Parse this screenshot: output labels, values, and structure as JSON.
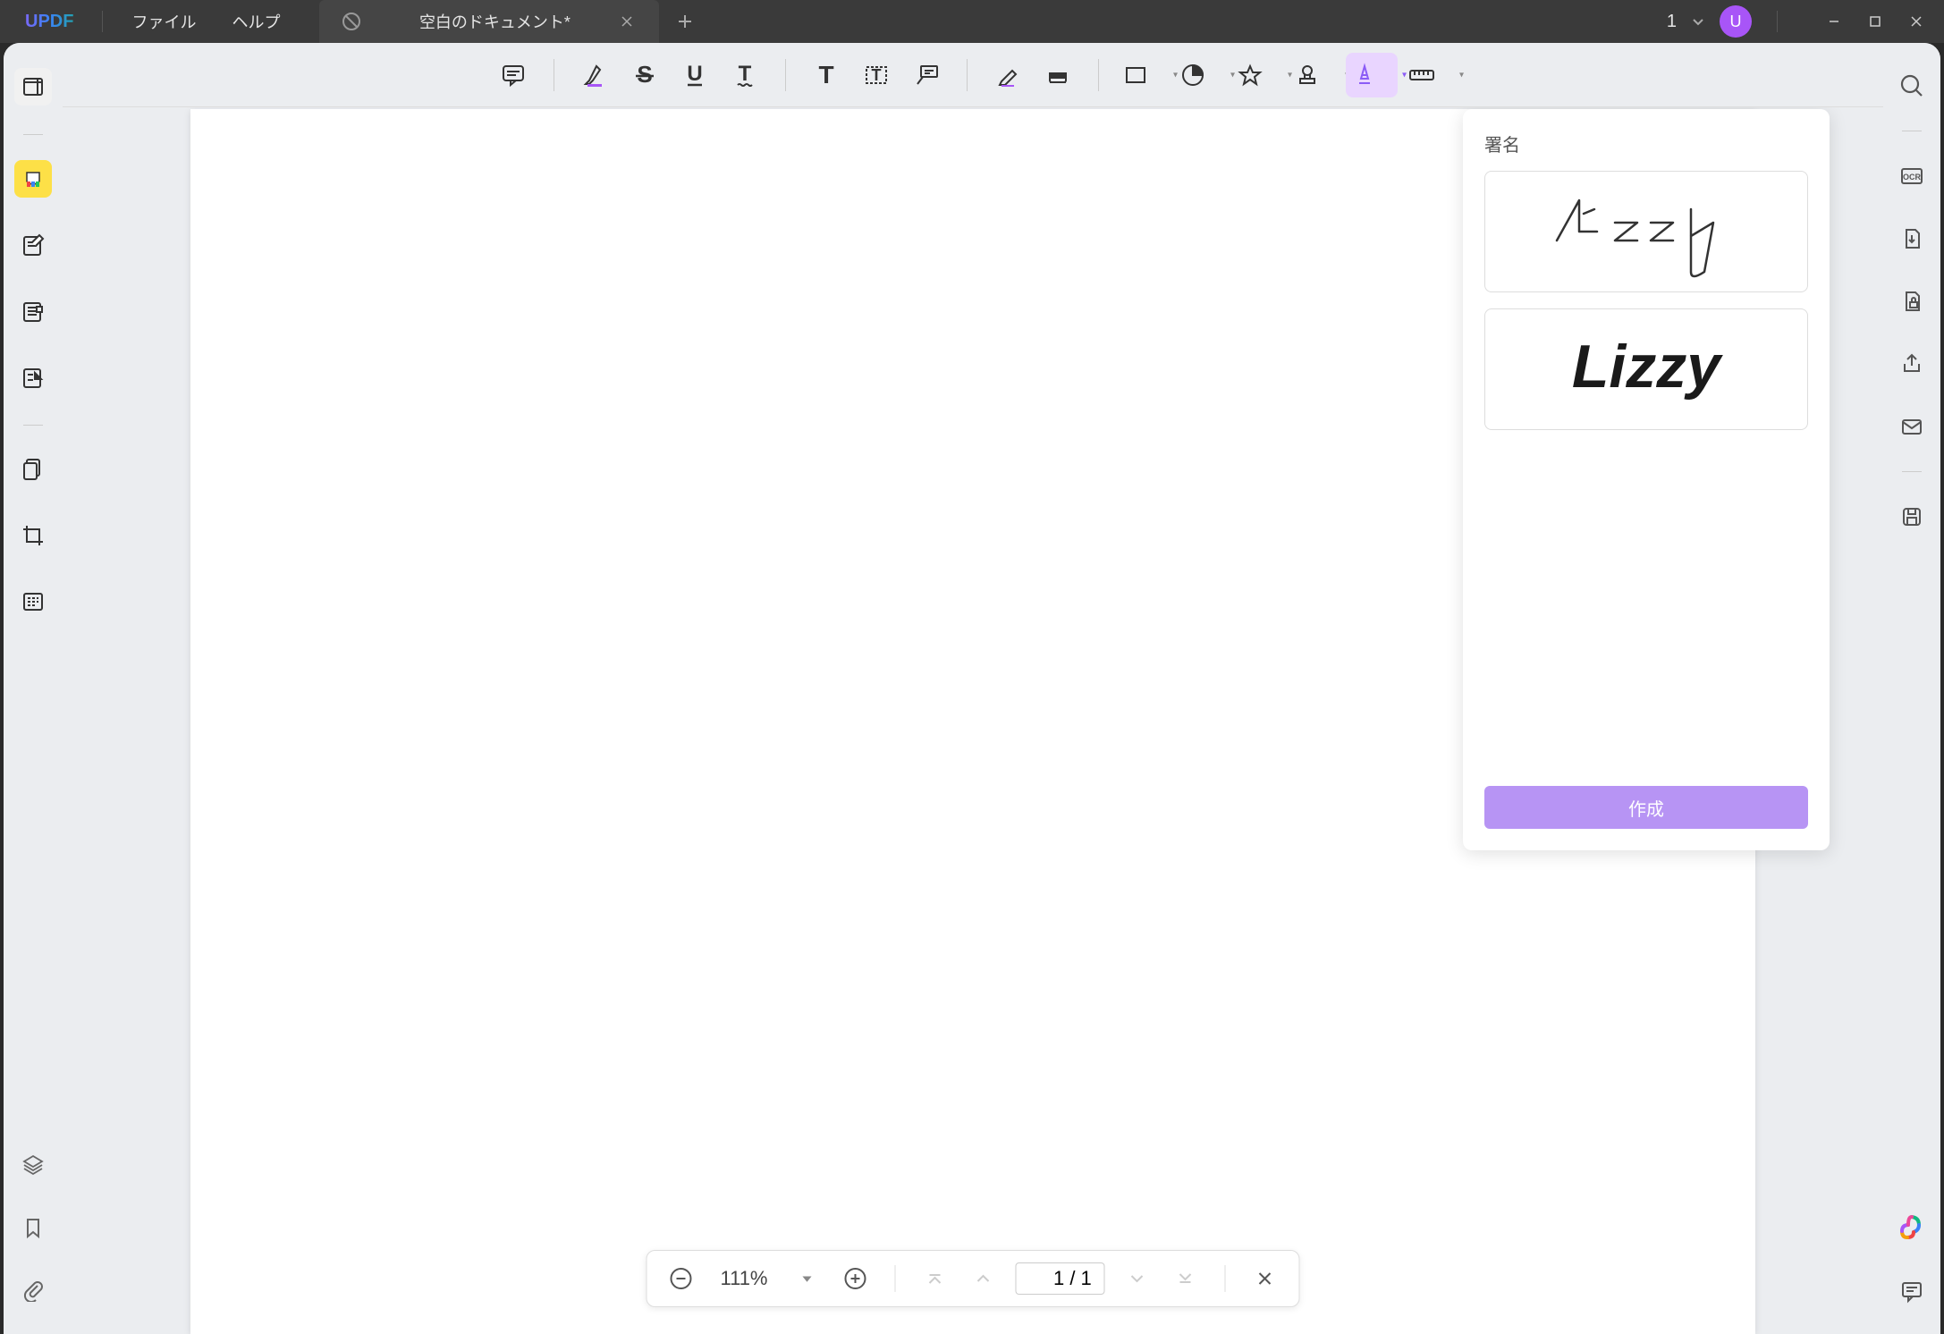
{
  "titlebar": {
    "logo": "UPDF",
    "menu": {
      "file": "ファイル",
      "help": "ヘルプ"
    },
    "tab_title": "空白のドキュメント*",
    "count": "1",
    "user_initial": "U"
  },
  "signature_panel": {
    "title": "署名",
    "create_button": "作成"
  },
  "page_nav": {
    "zoom": "111%",
    "current_page": "1",
    "total_pages": "1"
  }
}
